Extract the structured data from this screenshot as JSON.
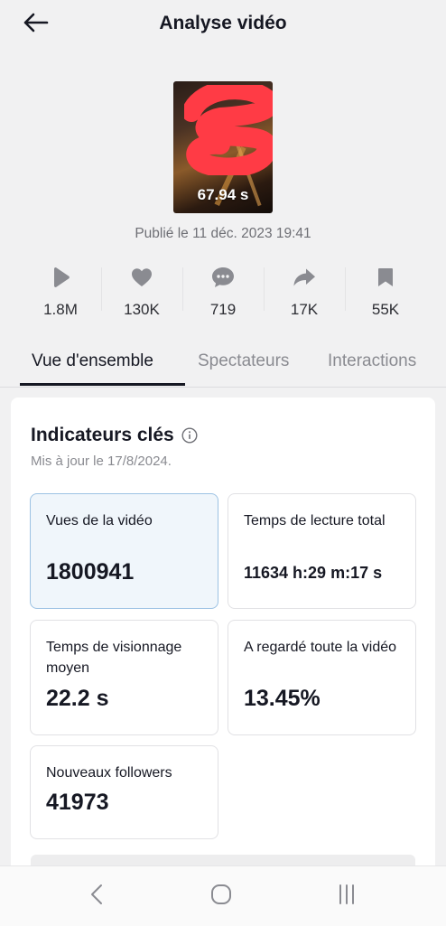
{
  "header": {
    "title": "Analyse vidéo",
    "back_icon": "arrow-left-icon"
  },
  "video": {
    "duration": "67.94 s",
    "published": "Publié le 11 déc. 2023 19:41"
  },
  "stats": [
    {
      "icon": "play-icon",
      "value": "1.8M"
    },
    {
      "icon": "heart-icon",
      "value": "130K"
    },
    {
      "icon": "comment-icon",
      "value": "719"
    },
    {
      "icon": "share-icon",
      "value": "17K"
    },
    {
      "icon": "bookmark-icon",
      "value": "55K"
    }
  ],
  "tabs": [
    {
      "label": "Vue d'ensemble",
      "active": true
    },
    {
      "label": "Spectateurs",
      "active": false
    },
    {
      "label": "Interactions",
      "active": false
    }
  ],
  "key_metrics": {
    "title": "Indicateurs clés",
    "updated": "Mis à jour le 17/8/2024.",
    "cards": [
      {
        "label": "Vues de la vidéo",
        "value": "1800941"
      },
      {
        "label": "Temps de lecture total",
        "value": "11634 h:29 m:17 s"
      },
      {
        "label": "Temps de visionnage moyen",
        "value": "22.2 s"
      },
      {
        "label": "A regardé toute la vidéo",
        "value": "13.45%"
      },
      {
        "label": "Nouveaux followers",
        "value": "41973"
      }
    ]
  },
  "colors": {
    "accent_border": "#9cc2e3",
    "selected_bg": "#f0f6fb",
    "redaction": "#ff3b45"
  },
  "navbar": [
    "chevron-left-icon",
    "home-circle-icon",
    "recent-apps-icon"
  ]
}
